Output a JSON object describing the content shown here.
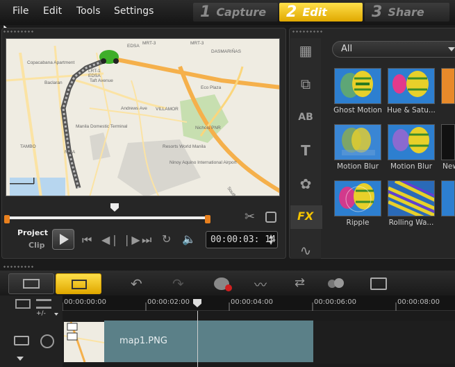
{
  "menu": {
    "file": "File",
    "edit": "Edit",
    "tools": "Tools",
    "settings": "Settings"
  },
  "steps": [
    {
      "num": "1",
      "label": "Capture"
    },
    {
      "num": "2",
      "label": "Edit"
    },
    {
      "num": "3",
      "label": "Share"
    }
  ],
  "player": {
    "project_label": "Project",
    "clip_label": "Clip",
    "timecode": "00:00:03: 14"
  },
  "map_labels": {
    "edsa1": "EDSA",
    "mrt3": "MRT-3",
    "edsa2": "EDSA",
    "mrt3b": "MRT-3",
    "dasmarinas": "DASMARIÑAS",
    "villages": "VILLAGE",
    "copacabana": "Copacabana Apartment",
    "lrt1": "LRT-1",
    "edsa3": "EDSA",
    "taft": "Taft Avenue",
    "baclaran": "Baclaran",
    "nichols": "Nichols PNR",
    "resorts": "Resorts World Manila",
    "ninoy": "Ninoy Aquino International Airport",
    "domestic": "Manila Domestic Terminal",
    "villamor": "VILLAMOR",
    "tambo": "TAMBO",
    "naia": "NAIA",
    "slex": "South Luzon Expressway",
    "andrews": "Andrews Ave",
    "sales": "Sales St",
    "ecoplaza": "Eco Plaza"
  },
  "library": {
    "dropdown": "All",
    "tabs": [
      "media-icon",
      "transition-icon",
      "title-ab-icon",
      "text-t-icon",
      "graphics-icon",
      "fx-icon",
      "path-icon"
    ],
    "fx_label": "FX",
    "items": [
      {
        "label": "Ghost Motion"
      },
      {
        "label": "Hue & Satu..."
      },
      {
        "label": "Motion Blur"
      },
      {
        "label": "Motion Blur"
      },
      {
        "label": "New"
      },
      {
        "label": "Ripple"
      },
      {
        "label": "Rolling Wa..."
      }
    ]
  },
  "timeline": {
    "ticks": [
      "00:00:00:00",
      "00:00:02:00",
      "00:00:04:00",
      "00:00:06:00",
      "00:00:08:00"
    ],
    "clip_name": "map1.PNG",
    "zoom": "+/-"
  },
  "colors": {
    "accent": "#f5c400",
    "clip": "#5b8088",
    "route_marker": "#3fae2a",
    "road": "#f5b04b"
  }
}
